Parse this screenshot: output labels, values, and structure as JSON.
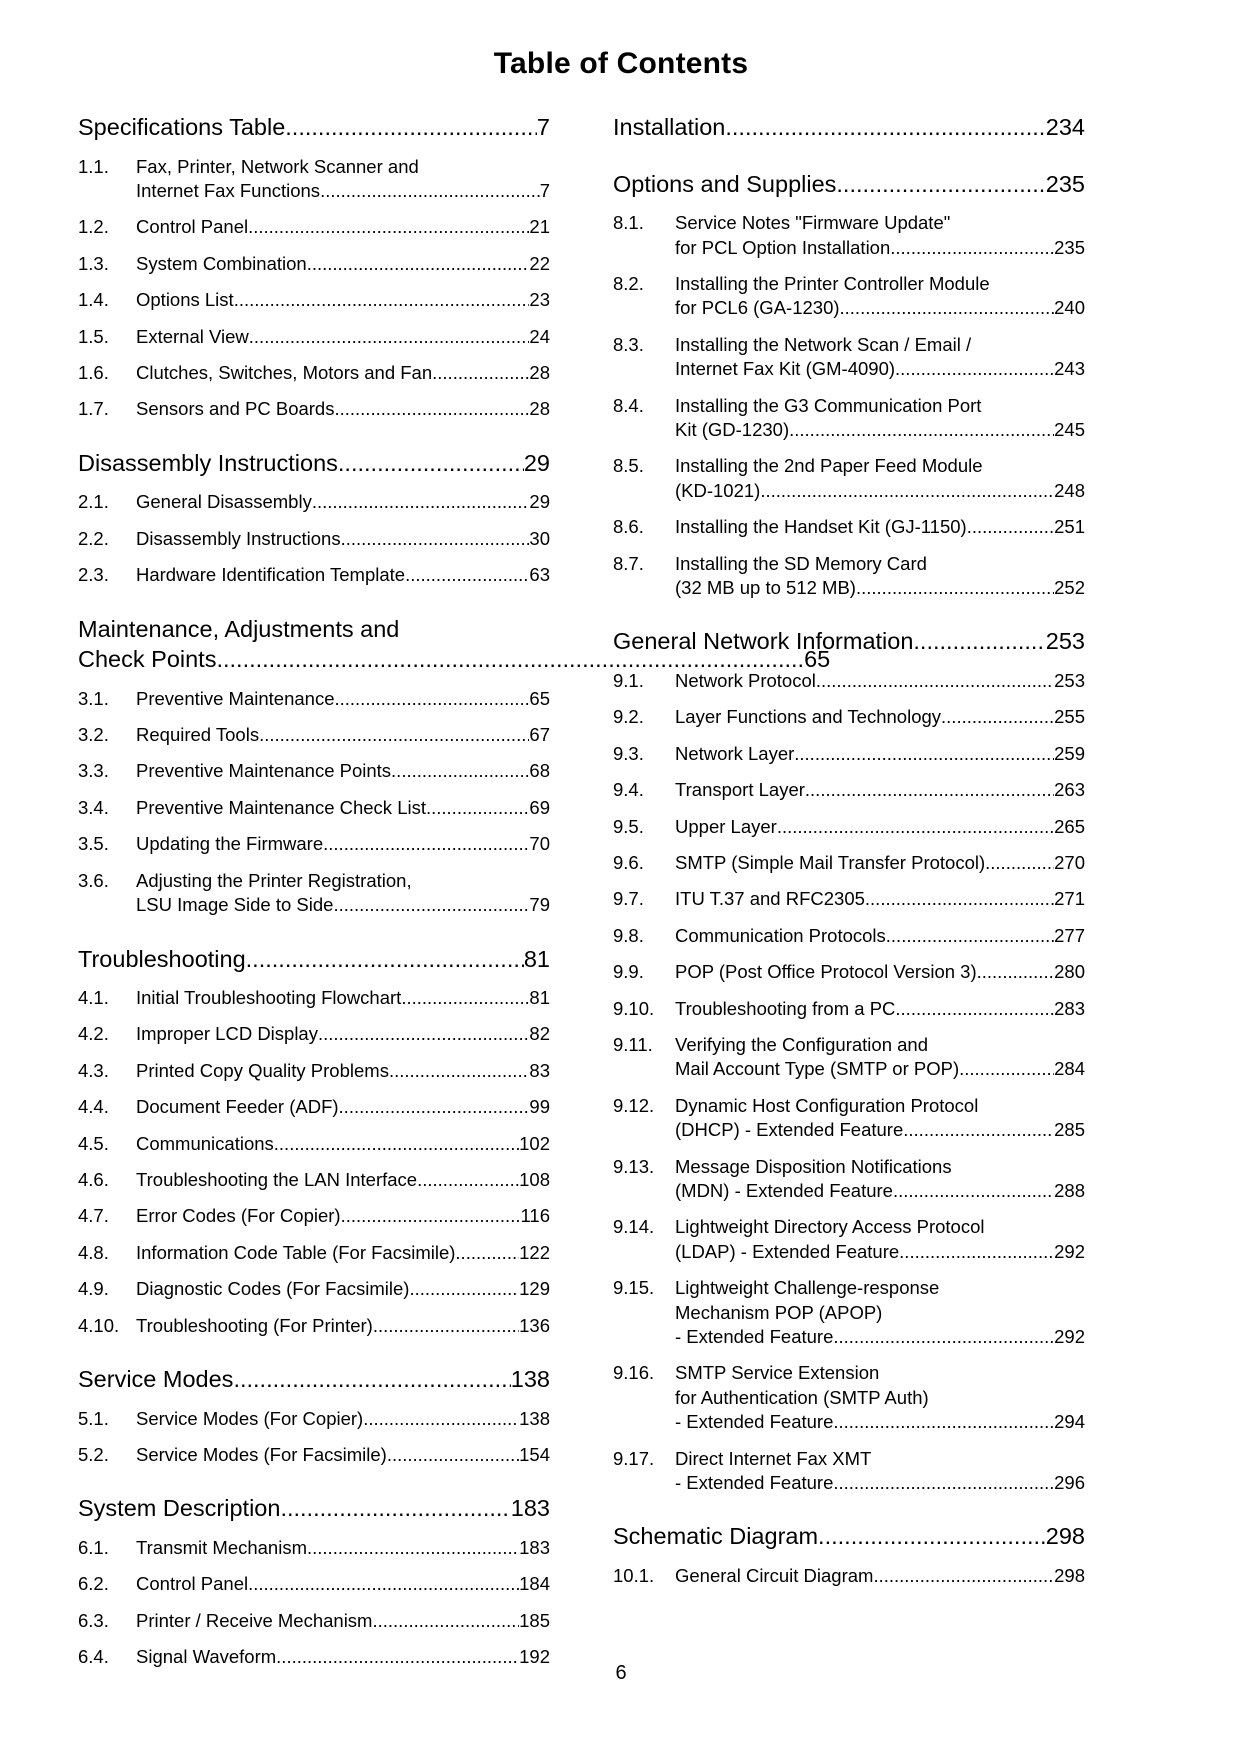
{
  "page": {
    "title": "Table of Contents",
    "footer_page_number": "6"
  },
  "left_column": [
    {
      "type": "chapter",
      "title": "Specifications Table",
      "page": "7",
      "sections": [
        {
          "num": "1.1.",
          "lines": [
            "Fax, Printer, Network Scanner and",
            "Internet Fax Functions"
          ],
          "page": "7"
        },
        {
          "num": "1.2.",
          "lines": [
            "Control Panel"
          ],
          "page": "21"
        },
        {
          "num": "1.3.",
          "lines": [
            "System Combination"
          ],
          "page": "22"
        },
        {
          "num": "1.4.",
          "lines": [
            "Options List"
          ],
          "page": "23"
        },
        {
          "num": "1.5.",
          "lines": [
            "External View"
          ],
          "page": "24"
        },
        {
          "num": "1.6.",
          "lines": [
            "Clutches, Switches, Motors and Fan"
          ],
          "page": "28"
        },
        {
          "num": "1.7.",
          "lines": [
            "Sensors and PC Boards"
          ],
          "page": "28"
        }
      ]
    },
    {
      "type": "chapter",
      "title": "Disassembly Instructions",
      "page": "29",
      "sections": [
        {
          "num": "2.1.",
          "lines": [
            "General Disassembly"
          ],
          "page": "29"
        },
        {
          "num": "2.2.",
          "lines": [
            "Disassembly Instructions"
          ],
          "page": "30"
        },
        {
          "num": "2.3.",
          "lines": [
            "Hardware Identification Template"
          ],
          "page": "63"
        }
      ]
    },
    {
      "type": "chapter-multiline",
      "title_line1": "Maintenance, Adjustments and",
      "title_line2": "Check Points",
      "page": "65",
      "sections": [
        {
          "num": "3.1.",
          "lines": [
            "Preventive Maintenance"
          ],
          "page": "65"
        },
        {
          "num": "3.2.",
          "lines": [
            "Required Tools"
          ],
          "page": "67"
        },
        {
          "num": "3.3.",
          "lines": [
            "Preventive Maintenance Points"
          ],
          "page": "68"
        },
        {
          "num": "3.4.",
          "lines": [
            "Preventive Maintenance Check List"
          ],
          "page": "69"
        },
        {
          "num": "3.5.",
          "lines": [
            "Updating the Firmware"
          ],
          "page": "70"
        },
        {
          "num": "3.6.",
          "lines": [
            "Adjusting the Printer Registration,",
            "LSU Image Side to Side"
          ],
          "page": "79"
        }
      ]
    },
    {
      "type": "chapter",
      "title": "Troubleshooting",
      "page": "81",
      "sections": [
        {
          "num": "4.1.",
          "lines": [
            "Initial Troubleshooting Flowchart"
          ],
          "page": "81"
        },
        {
          "num": "4.2.",
          "lines": [
            "Improper LCD Display"
          ],
          "page": "82"
        },
        {
          "num": "4.3.",
          "lines": [
            "Printed Copy Quality Problems"
          ],
          "page": "83"
        },
        {
          "num": "4.4.",
          "lines": [
            "Document Feeder (ADF)"
          ],
          "page": "99"
        },
        {
          "num": "4.5.",
          "lines": [
            "Communications"
          ],
          "page": "102"
        },
        {
          "num": "4.6.",
          "lines": [
            "Troubleshooting the LAN Interface"
          ],
          "page": "108"
        },
        {
          "num": "4.7.",
          "lines": [
            "Error Codes (For Copier)"
          ],
          "page": "116"
        },
        {
          "num": "4.8.",
          "lines": [
            "Information Code Table (For Facsimile)"
          ],
          "page": "122"
        },
        {
          "num": "4.9.",
          "lines": [
            "Diagnostic Codes (For Facsimile)"
          ],
          "page": "129"
        },
        {
          "num": "4.10.",
          "lines": [
            "Troubleshooting (For Printer)"
          ],
          "page": "136"
        }
      ]
    },
    {
      "type": "chapter",
      "title": "Service Modes",
      "page": "138",
      "sections": [
        {
          "num": "5.1.",
          "lines": [
            "Service Modes (For Copier)"
          ],
          "page": "138"
        },
        {
          "num": "5.2.",
          "lines": [
            "Service Modes (For Facsimile)"
          ],
          "page": "154"
        }
      ]
    },
    {
      "type": "chapter",
      "title": "System Description",
      "page": "183",
      "sections": [
        {
          "num": "6.1.",
          "lines": [
            "Transmit Mechanism"
          ],
          "page": "183"
        },
        {
          "num": "6.2.",
          "lines": [
            "Control Panel"
          ],
          "page": "184"
        },
        {
          "num": "6.3.",
          "lines": [
            "Printer / Receive Mechanism"
          ],
          "page": "185"
        },
        {
          "num": "6.4.",
          "lines": [
            "Signal Waveform"
          ],
          "page": "192"
        }
      ]
    }
  ],
  "right_column": [
    {
      "type": "chapter",
      "title": "Installation",
      "page": "234",
      "sections": []
    },
    {
      "type": "chapter",
      "title": "Options and Supplies",
      "page": "235",
      "sections": [
        {
          "num": "8.1.",
          "lines": [
            "Service Notes \"Firmware Update\"",
            "for PCL Option Installation "
          ],
          "page": "235"
        },
        {
          "num": "8.2.",
          "lines": [
            "Installing the Printer Controller Module",
            "for PCL6 (GA-1230)"
          ],
          "page": "240"
        },
        {
          "num": "8.3.",
          "lines": [
            "Installing the Network Scan / Email /",
            "Internet Fax Kit (GM-4090)"
          ],
          "page": "243"
        },
        {
          "num": "8.4.",
          "lines": [
            "Installing the G3 Communication Port",
            "Kit (GD-1230)"
          ],
          "page": "245"
        },
        {
          "num": "8.5.",
          "lines": [
            "Installing the 2nd Paper Feed Module",
            "(KD-1021)"
          ],
          "page": "248"
        },
        {
          "num": "8.6.",
          "lines": [
            "Installing the Handset Kit (GJ-1150)"
          ],
          "page": "251"
        },
        {
          "num": "8.7.",
          "lines": [
            "Installing the SD Memory Card",
            "(32 MB up to 512 MB)"
          ],
          "page": "252"
        }
      ]
    },
    {
      "type": "chapter",
      "title": "General Network Information",
      "page": "253",
      "sections": [
        {
          "num": "9.1.",
          "lines": [
            "Network Protocol"
          ],
          "page": "253"
        },
        {
          "num": "9.2.",
          "lines": [
            "Layer Functions and Technology"
          ],
          "page": "255"
        },
        {
          "num": "9.3.",
          "lines": [
            "Network Layer"
          ],
          "page": "259"
        },
        {
          "num": "9.4.",
          "lines": [
            "Transport Layer"
          ],
          "page": "263"
        },
        {
          "num": "9.5.",
          "lines": [
            "Upper Layer"
          ],
          "page": "265"
        },
        {
          "num": "9.6.",
          "lines": [
            "SMTP (Simple Mail Transfer Protocol)"
          ],
          "page": "270"
        },
        {
          "num": "9.7.",
          "lines": [
            "ITU T.37 and RFC2305"
          ],
          "page": "271"
        },
        {
          "num": "9.8.",
          "lines": [
            "Communication Protocols"
          ],
          "page": "277"
        },
        {
          "num": "9.9.",
          "lines": [
            "POP (Post Office Protocol Version 3)"
          ],
          "page": "280"
        },
        {
          "num": "9.10.",
          "lines": [
            "Troubleshooting from a PC"
          ],
          "page": "283"
        },
        {
          "num": "9.11.",
          "lines": [
            "Verifying the Configuration and",
            "Mail Account Type (SMTP or POP)"
          ],
          "page": "284"
        },
        {
          "num": "9.12.",
          "lines": [
            "Dynamic Host Configuration Protocol",
            "(DHCP) - Extended Feature"
          ],
          "page": "285"
        },
        {
          "num": "9.13.",
          "lines": [
            "Message Disposition Notifications",
            "(MDN) - Extended Feature"
          ],
          "page": "288"
        },
        {
          "num": "9.14.",
          "lines": [
            "Lightweight Directory Access Protocol",
            "(LDAP) - Extended Feature"
          ],
          "page": "292"
        },
        {
          "num": "9.15.",
          "lines": [
            "Lightweight Challenge-response",
            "Mechanism POP (APOP)",
            "- Extended Feature"
          ],
          "page": "292"
        },
        {
          "num": "9.16.",
          "lines": [
            "SMTP Service Extension",
            "for Authentication (SMTP Auth)",
            "- Extended Feature"
          ],
          "page": "294"
        },
        {
          "num": "9.17.",
          "lines": [
            "Direct Internet Fax XMT",
            "- Extended Feature"
          ],
          "page": "296"
        }
      ]
    },
    {
      "type": "chapter",
      "title": "Schematic Diagram",
      "page": "298",
      "sections": [
        {
          "num": "10.1.",
          "lines": [
            "General Circuit Diagram"
          ],
          "page": "298"
        }
      ]
    }
  ]
}
